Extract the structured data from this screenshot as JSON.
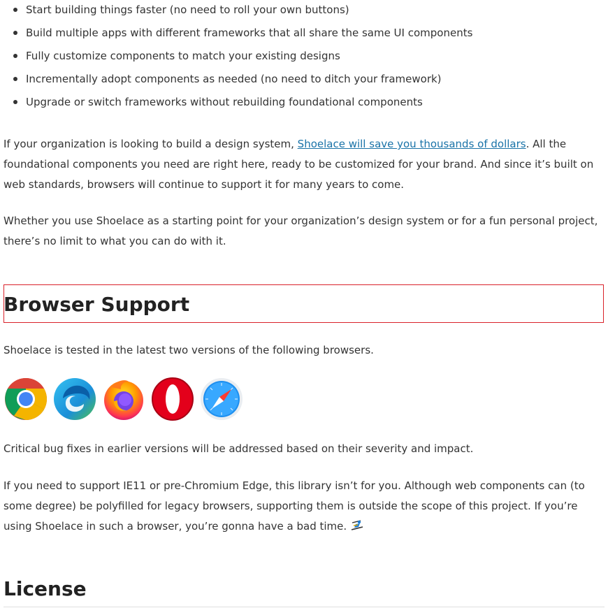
{
  "bullets": [
    "Start building things faster (no need to roll your own buttons)",
    "Build multiple apps with different frameworks that all share the same UI components",
    "Fully customize components to match your existing designs",
    "Incrementally adopt components as needed (no need to ditch your framework)",
    "Upgrade or switch frameworks without rebuilding foundational components"
  ],
  "design_system": {
    "before": "If your organization is looking to build a design system, ",
    "link": "Shoelace will save you thousands of dollars",
    "after": ". All the foundational components you need are right here, ready to be customized for your brand. And since it’s built on web standards, browsers will continue to support it for many years to come."
  },
  "whether": "Whether you use Shoelace as a starting point for your organization’s design system or for a fun personal project, there’s no limit to what you can do with it.",
  "browser_support": {
    "heading": "Browser Support",
    "intro": "Shoelace is tested in the latest two versions of the following browsers.",
    "browsers": [
      "chrome-icon",
      "edge-icon",
      "firefox-icon",
      "opera-icon",
      "safari-icon"
    ],
    "critical": "Critical bug fixes in earlier versions will be addressed based on their severity and impact.",
    "ie11": "If you need to support IE11 or pre-Chromium Edge, this library isn’t for you. Although web components can (to some degree) be polyfilled for legacy browsers, supporting them is outside the scope of this project. If you’re using Shoelace in such a browser, you’re gonna have a bad time.",
    "emoji": "skier-emoji"
  },
  "license": {
    "heading": "License"
  },
  "colors": {
    "link": "#1a73a8",
    "highlight_border": "#d9222a",
    "text": "#333333"
  }
}
